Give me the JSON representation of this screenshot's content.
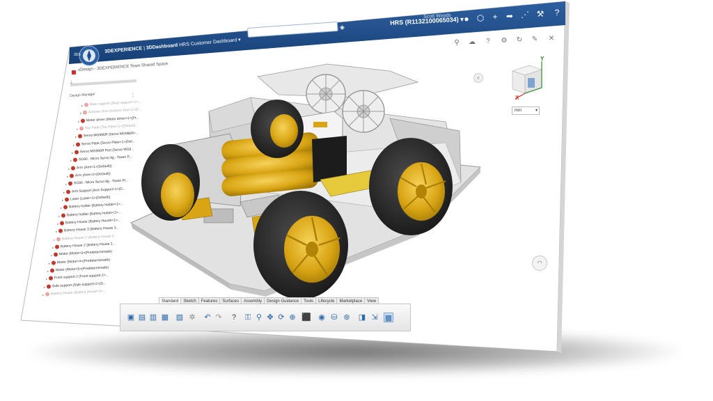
{
  "header": {
    "app_prefix": "3DEXPERIENCE",
    "app_separator": " | ",
    "app_name": "3DDashboard",
    "dashboard": "HRS Customer Dashboard",
    "user_name": "Scott Woods",
    "tenant": "HRS (R1132100065034)",
    "search_placeholder": ""
  },
  "space": {
    "title": "xDesign - 3DEXPERIENCE Team Shared Space",
    "panel_label": "Design Manager"
  },
  "tree": {
    "items": [
      {
        "label": "Rear support (Rear support<1>...",
        "dim": true
      },
      {
        "label": "Arduino Uno (Arduino Uno<1>(D...",
        "dim": true
      },
      {
        "label": "Motor driver (Motor driver<1>(Pr...",
        "dim": false
      },
      {
        "label": "Top Plate (Top Plate<1>(Default)...",
        "dim": true
      },
      {
        "label": "Servo MG996R (Servo MG996R<...",
        "dim": false
      },
      {
        "label": "Servo Plate (Servo Plate<1>(Def...",
        "dim": false
      },
      {
        "label": "Servo MG996R Part (Servo MG9...",
        "dim": false
      },
      {
        "label": "SG90 - Micro Servo 9g - Tower P...",
        "dim": false
      },
      {
        "label": "Arm (Arm<1>(Default))",
        "dim": false
      },
      {
        "label": "Arm (Arm<2>(Default))",
        "dim": false
      },
      {
        "label": "SG90 - Micro Servo 9g - Tower Pr...",
        "dim": false
      },
      {
        "label": "Arm Support (Arm Support<1>(D...",
        "dim": false
      },
      {
        "label": "Laser (Laser<1>(Default))",
        "dim": false
      },
      {
        "label": "Battery holder (Battery holder<1>...",
        "dim": false
      },
      {
        "label": "Battery holder (Battery holder<2>...",
        "dim": false
      },
      {
        "label": "Battery House (Battery House<1>...",
        "dim": false
      },
      {
        "label": "Battery House 3 (Battery House 3...",
        "dim": false
      },
      {
        "label": "Battery House 2 (Battery House 2...",
        "dim": true
      },
      {
        "label": "Battery House 2 (Battery House 2...",
        "dim": false
      },
      {
        "label": "Motor (Motor<3>(Predeterminado)",
        "dim": false
      },
      {
        "label": "Motor (Motor<4>(Predeterminado)",
        "dim": false
      },
      {
        "label": "Motor (Motor<5>(Predeterminado)",
        "dim": false
      },
      {
        "label": "Front support 2 (Front support 2<...",
        "dim": false
      },
      {
        "label": "Side support (Side support<2>(D...",
        "dim": false
      },
      {
        "label": "Battery House (Battery House<2>...",
        "dim": true
      }
    ]
  },
  "viewport": {
    "units": "mm",
    "axis_x": "X",
    "axis_y": "Y"
  },
  "action_bar": {
    "tabs": [
      "Standard",
      "Sketch",
      "Features",
      "Surfaces",
      "Assembly",
      "Design Guidance",
      "Tools",
      "Lifecycle",
      "Marketplace",
      "View"
    ],
    "active_tab": "Standard"
  },
  "colors": {
    "topbar": "#1f4d8a",
    "topbar_light": "#3b6fb0",
    "accent_gold": "#d9a514",
    "tire": "#2a2a2a",
    "plate": "#dadada"
  }
}
